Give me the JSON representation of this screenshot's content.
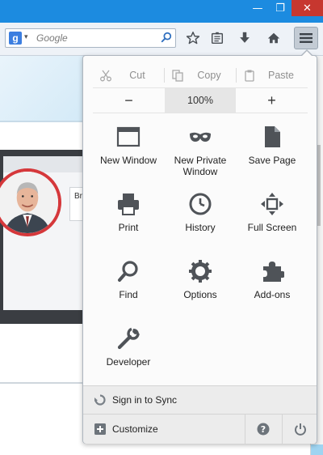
{
  "window": {
    "controls": {
      "minimize_glyph": "—",
      "maximize_glyph": "❐",
      "close_glyph": "✕"
    }
  },
  "toolbar": {
    "search": {
      "engine_icon": "google-icon",
      "engine_letter": "g",
      "placeholder": "Google"
    },
    "buttons": [
      "bookmark-star-icon",
      "reading-list-icon",
      "download-icon",
      "home-icon",
      "hamburger-menu-icon"
    ]
  },
  "page": {
    "card_text": "Br"
  },
  "menu": {
    "edit": {
      "cut": "Cut",
      "copy": "Copy",
      "paste": "Paste"
    },
    "zoom": {
      "minus": "−",
      "level": "100%",
      "plus": "+"
    },
    "items": [
      {
        "label": "New Window",
        "icon": "new-window-icon"
      },
      {
        "label": "New Private\nWindow",
        "icon": "private-mask-icon"
      },
      {
        "label": "Save Page",
        "icon": "save-page-icon"
      },
      {
        "label": "Print",
        "icon": "printer-icon"
      },
      {
        "label": "History",
        "icon": "clock-icon"
      },
      {
        "label": "Full Screen",
        "icon": "fullscreen-icon"
      },
      {
        "label": "Find",
        "icon": "magnifier-icon"
      },
      {
        "label": "Options",
        "icon": "gear-icon"
      },
      {
        "label": "Add-ons",
        "icon": "puzzle-icon"
      },
      {
        "label": "Developer",
        "icon": "wrench-icon"
      }
    ],
    "sync": {
      "label": "Sign in to Sync",
      "icon": "sync-icon"
    },
    "customize": {
      "label": "Customize",
      "icon": "plus-square-icon"
    },
    "help_icon": "help-icon",
    "quit_icon": "power-icon"
  },
  "colors": {
    "titlebar": "#1c8be0",
    "close": "#c7372f",
    "avatar_ring": "#d5383b"
  }
}
